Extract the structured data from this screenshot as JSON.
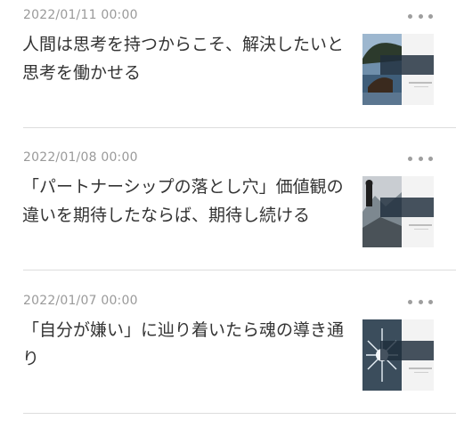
{
  "posts": [
    {
      "date": "2022/01/11 00:00",
      "title": "人間は思考を持つからこそ、解決したいと思考を働かせる",
      "thumbnail_icon": "landscape-image-icon"
    },
    {
      "date": "2022/01/08 00:00",
      "title": "「パートナーシップの落とし穴」価値観の違いを期待したならば、期待し続ける",
      "thumbnail_icon": "mountain-person-image-icon"
    },
    {
      "date": "2022/01/07 00:00",
      "title": "「自分が嫌い」に辿り着いたら魂の導き通り",
      "thumbnail_icon": "frost-image-icon"
    }
  ],
  "colors": {
    "date": "#9a9a9a",
    "title": "#333333",
    "menu_dots": "#9e9e9e",
    "divider": "#dddddd"
  }
}
